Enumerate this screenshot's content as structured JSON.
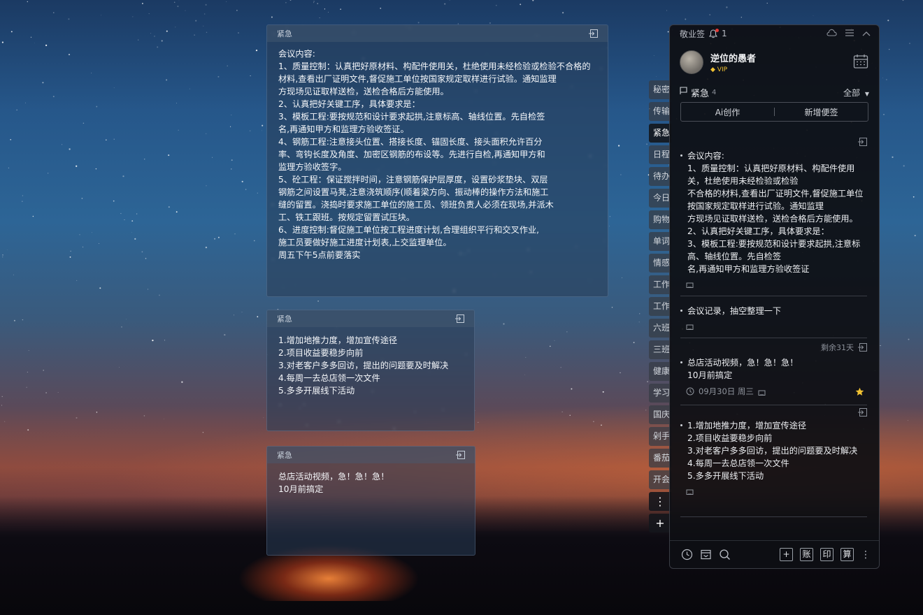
{
  "notes": [
    {
      "header": "紧急",
      "body": "会议内容:\n1、质量控制：认真把好原材料、构配件使用关，杜绝使用未经检验或检验不合格的材料,查看出厂证明文件,督促施工单位按国家规定取样进行试验。通知监理\n方现场见证取样送检，送检合格后方能使用。\n2、认真把好关键工序，具体要求是：\n3、模板工程:要按规范和设计要求起拱,注意标高、轴线位置。先自检签\n名,再通知甲方和监理方验收签证。\n4、钢筋工程:注意接头位置、搭接长度、锚固长度、接头面积允许百分\n率、弯钩长度及角度、加密区钢筋的布设等。先进行自检,再通知甲方和\n监理方验收签字。\n5、砼工程：保证搅拌时间，注意钢筋保护层厚度，设置砂浆垫块、双层\n钢筋之间设置马凳,注意浇筑顺序(顺着梁方向、振动棒的操作方法和施工\n缝的留置。浇捣时要求施工单位的施工员、领班负责人必须在现场,并派木\n工、铁工跟班。按规定留置试压块。\n6、进度控制:督促施工单位按工程进度计划,合理组织平行和交叉作业,\n施工员要做好施工进度计划表,上交监理单位。\n周五下午5点前要落实"
    },
    {
      "header": "紧急",
      "body": "1.增加地推力度，增加宣传途径\n2.项目收益要稳步向前\n3.对老客户多多回访，提出的问题要及时解决\n4.每周一去总店领一次文件\n5.多多开展线下活动"
    },
    {
      "header": "紧急",
      "body": "总店活动视频，急！急！急！\n10月前搞定"
    }
  ],
  "side_tabs": [
    "秘密",
    "传输",
    "紧急",
    "日程",
    "待办",
    "今日",
    "购物",
    "单词",
    "情感",
    "工作",
    "工作",
    "六班",
    "三班",
    "健康",
    "学习",
    "国庆",
    "剁手",
    "番茄",
    "开会"
  ],
  "side_tab_more": "⋮",
  "side_tab_add": "+",
  "panel": {
    "app_name": "敬业签",
    "bell_count": "1",
    "user_name": "逆位的愚者",
    "vip_label": "VIP",
    "group_name": "紧急",
    "group_count": "4",
    "filter_label": "全部",
    "ai_button": "Ai创作",
    "new_button": "新增便签",
    "items": [
      {
        "text": "会议内容:\n1、质量控制：认真把好原材料、构配件使用关，杜绝使用未经检验或检验\n不合格的材料,查看出厂证明文件,督促施工单位按国家规定取样进行试验。通知监理\n方现场见证取样送检，送检合格后方能使用。\n2、认真把好关键工序，具体要求是：\n3、模板工程:要按规范和设计要求起拱,注意标高、轴线位置。先自检签\n名,再通知甲方和监理方验收签证"
      },
      {
        "text": "会议记录，抽空整理一下"
      },
      {
        "remaining": "剩余31天",
        "text": "总店活动视频，急！急！急！\n10月前搞定",
        "date": "09月30日 周三"
      },
      {
        "text": "1.增加地推力度，增加宣传途径\n2.项目收益要稳步向前\n3.对老客户多多回访，提出的问题要及时解决\n4.每周一去总店领一次文件\n5.多多开展线下活动"
      }
    ],
    "bottom_buttons": [
      "账",
      "印",
      "算"
    ]
  },
  "colors": {
    "accent_star": "#f1c232",
    "bell_dot": "#e53935"
  }
}
